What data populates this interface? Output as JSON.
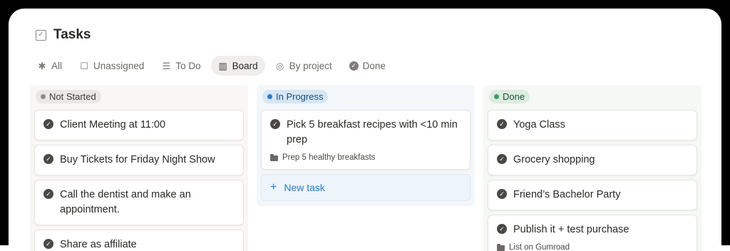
{
  "page": {
    "title": "Tasks",
    "title_icon": "checkbox-icon"
  },
  "tabs": [
    {
      "label": "All",
      "icon": "asterisk-icon",
      "active": false
    },
    {
      "label": "Unassigned",
      "icon": "square-icon",
      "active": false
    },
    {
      "label": "To Do",
      "icon": "checklist-icon",
      "active": false
    },
    {
      "label": "Board",
      "icon": "board-icon",
      "active": true
    },
    {
      "label": "By project",
      "icon": "target-icon",
      "active": false
    },
    {
      "label": "Done",
      "icon": "check-circle-icon",
      "active": false
    }
  ],
  "columns": {
    "not_started": {
      "label": "Not Started",
      "color": "#8e8c87",
      "cards": [
        {
          "title": "Client Meeting at 11:00"
        },
        {
          "title": "Buy Tickets for Friday Night Show"
        },
        {
          "title": "Call the dentist and make an appointment."
        },
        {
          "title": "Share as affiliate"
        }
      ]
    },
    "in_progress": {
      "label": "In Progress",
      "color": "#2c7cc4",
      "cards": [
        {
          "title": "Pick 5 breakfast recipes with <10 min prep",
          "project": "Prep 5 healthy breakfasts"
        }
      ],
      "new_task_label": "New task"
    },
    "done": {
      "label": "Done",
      "color": "#3f9b64",
      "cards": [
        {
          "title": "Yoga Class"
        },
        {
          "title": "Grocery shopping"
        },
        {
          "title": "Friend’s Bachelor Party"
        },
        {
          "title": "Publish it + test purchase",
          "project": "List on Gumroad"
        }
      ]
    }
  }
}
